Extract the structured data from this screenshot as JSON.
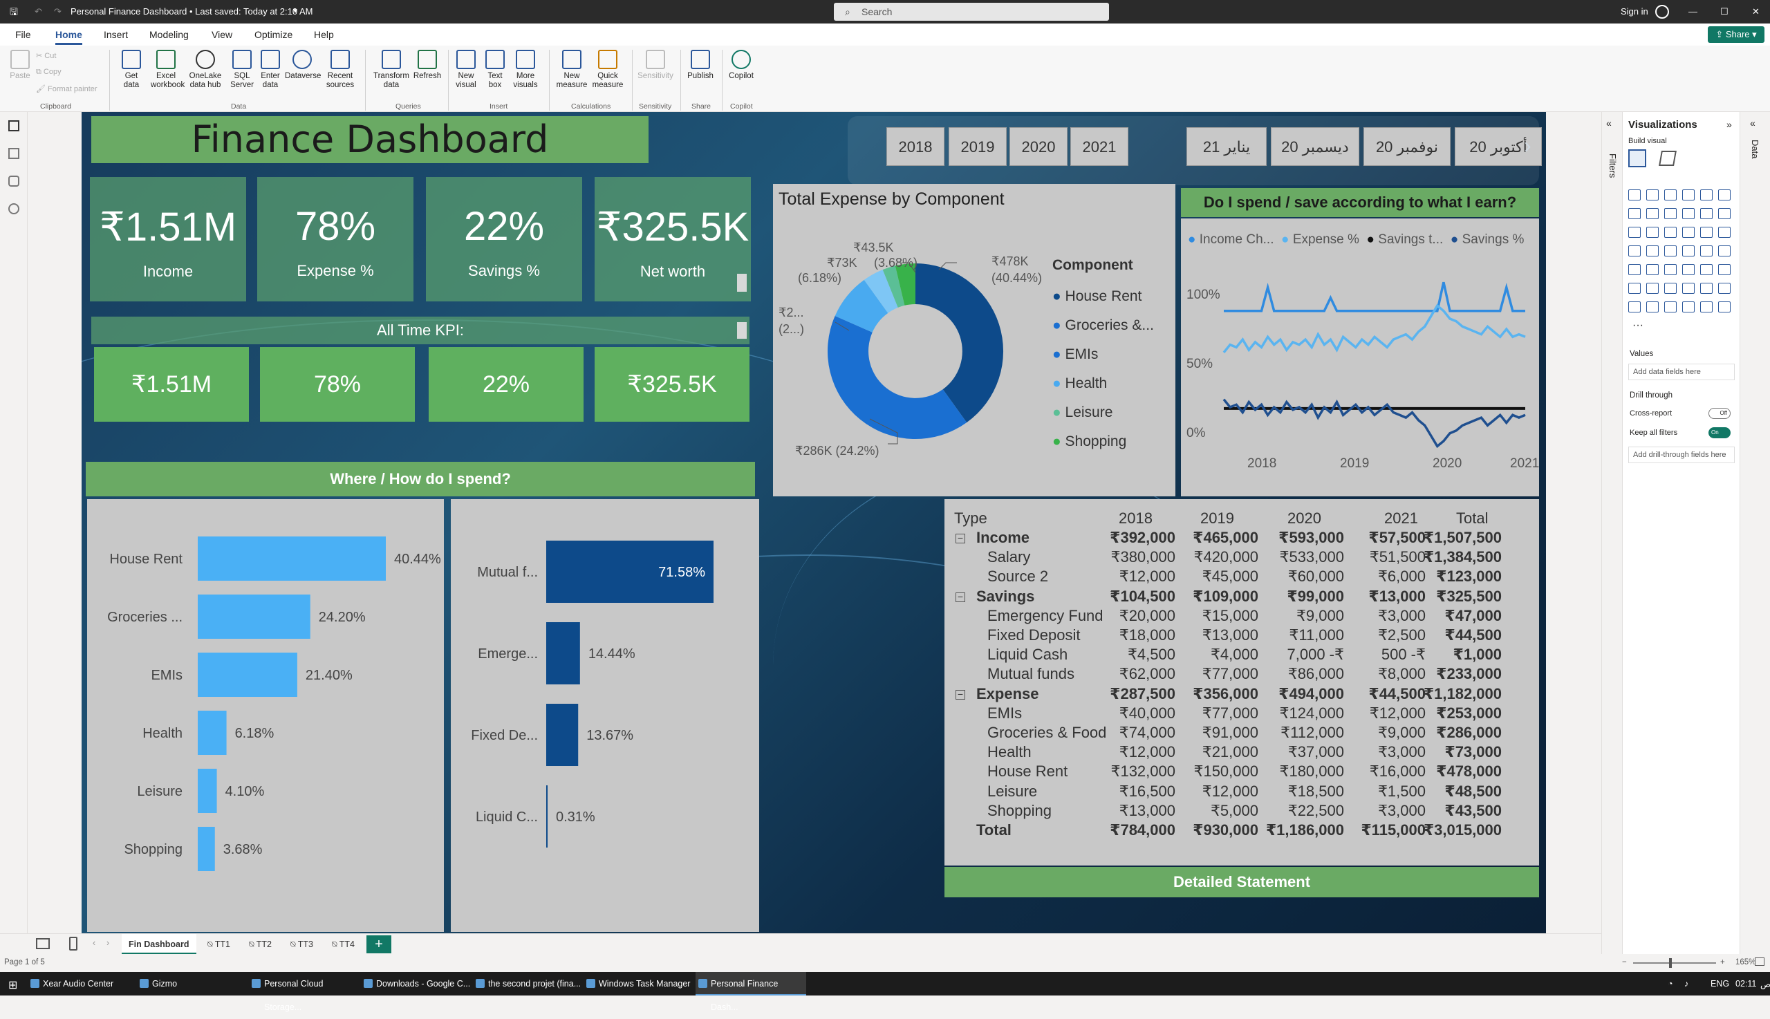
{
  "window": {
    "title": "Personal Finance Dashboard • Last saved: Today at 2:10 AM",
    "search_placeholder": "Search",
    "sign_in": "Sign in",
    "share": "Share"
  },
  "menu": [
    "File",
    "Home",
    "Insert",
    "Modeling",
    "View",
    "Optimize",
    "Help"
  ],
  "ribbon": {
    "clipboard": {
      "paste": "Paste",
      "cut": "Cut",
      "copy": "Copy",
      "format_painter": "Format painter",
      "group": "Clipboard"
    },
    "data_items": [
      "Get data",
      "Excel workbook",
      "OneLake data hub",
      "SQL Server",
      "Enter data",
      "Dataverse",
      "Recent sources"
    ],
    "data_group": "Data",
    "queries_items": [
      "Transform data",
      "Refresh"
    ],
    "queries_group": "Queries",
    "insert_items": [
      "New visual",
      "Text box",
      "More visuals"
    ],
    "insert_group": "Insert",
    "calc_items": [
      "New measure",
      "Quick measure"
    ],
    "calc_group": "Calculations",
    "sensitivity_items": [
      "Sensitivity"
    ],
    "sensitivity_group": "Sensitivity",
    "share_items": [
      "Publish"
    ],
    "share_group": "Share",
    "copilot_items": [
      "Copilot"
    ],
    "copilot_group": "Copilot"
  },
  "dashboard": {
    "title": "Finance Dashboard",
    "years": [
      "2018",
      "2019",
      "2020",
      "2021"
    ],
    "months": [
      "21 يناير",
      "20 ديسمبر",
      "20 نوفمبر",
      "20 أكتوبر"
    ],
    "kpis": [
      {
        "value": "₹1.51M",
        "label": "Income"
      },
      {
        "value": "78%",
        "label": "Expense %"
      },
      {
        "value": "22%",
        "label": "Savings %"
      },
      {
        "value": "₹325.5K",
        "label": "Net worth"
      }
    ],
    "all_time_title": "All Time KPI:",
    "all_time": [
      "₹1.51M",
      "78%",
      "22%",
      "₹325.5K"
    ],
    "spend_title": "Where / How do I spend?",
    "spend_left": [
      {
        "label": "House Rent",
        "pct": 40.44,
        "text": "40.44%"
      },
      {
        "label": "Groceries ...",
        "pct": 24.2,
        "text": "24.20%"
      },
      {
        "label": "EMIs",
        "pct": 21.4,
        "text": "21.40%"
      },
      {
        "label": "Health",
        "pct": 6.18,
        "text": "6.18%"
      },
      {
        "label": "Leisure",
        "pct": 4.1,
        "text": "4.10%"
      },
      {
        "label": "Shopping",
        "pct": 3.68,
        "text": "3.68%"
      }
    ],
    "spend_right": [
      {
        "label": "Mutual f...",
        "pct": 71.58,
        "text": "71.58%"
      },
      {
        "label": "Emerge...",
        "pct": 14.44,
        "text": "14.44%"
      },
      {
        "label": "Fixed De...",
        "pct": 13.67,
        "text": "13.67%"
      },
      {
        "label": "Liquid C...",
        "pct": 0.31,
        "text": "0.31%"
      }
    ],
    "statement_title": "Detailed Statement"
  },
  "donut": {
    "title": "Total Expense by Component",
    "legend_title": "Component",
    "legend": [
      "House Rent",
      "Groceries &...",
      "EMIs",
      "Health",
      "Leisure",
      "Shopping"
    ],
    "labels": {
      "house": "₹478K",
      "house_pct": "(40.44%)",
      "groc": "₹286K (24.2%)",
      "emi": "₹2...",
      "emi_pct": "(2...)",
      "health": "₹73K",
      "health_pct": "(6.18%)",
      "leisure": "₹43.5K",
      "leisure_pct": "(3.68%)"
    }
  },
  "chart_data": {
    "type": "line",
    "title": "Do I spend / save according to what I earn?",
    "legend": [
      "Income Ch...",
      "Expense %",
      "Savings t...",
      "Savings %"
    ],
    "x_ticks": [
      "2018",
      "2019",
      "2020",
      "2021"
    ],
    "y_ticks": [
      "0%",
      "50%",
      "100%"
    ],
    "ylim": [
      0,
      120
    ],
    "series": [
      {
        "name": "Income Ch...",
        "color": "#2f8be0",
        "values": [
          100,
          100,
          100,
          100,
          100,
          100,
          100,
          118,
          100,
          100,
          100,
          100,
          100,
          100,
          100,
          100,
          100,
          110,
          100,
          100,
          100,
          100,
          100,
          100,
          100,
          100,
          100,
          100,
          100,
          100,
          100,
          100,
          100,
          100,
          100,
          122,
          100,
          100,
          100,
          100,
          100,
          100,
          100,
          100,
          100,
          118,
          100,
          100,
          100
        ]
      },
      {
        "name": "Expense %",
        "color": "#5ab4f0",
        "values": [
          68,
          74,
          72,
          78,
          70,
          76,
          72,
          80,
          74,
          78,
          70,
          76,
          74,
          78,
          72,
          82,
          74,
          78,
          70,
          80,
          76,
          72,
          78,
          74,
          80,
          76,
          72,
          78,
          80,
          82,
          78,
          84,
          88,
          96,
          104,
          100,
          94,
          92,
          88,
          86,
          84,
          82,
          88,
          84,
          80,
          86,
          80,
          82,
          80
        ]
      },
      {
        "name": "Savings t...",
        "color": "#111111",
        "values": [
          25,
          25,
          25,
          25,
          25,
          25,
          25,
          25,
          25,
          25,
          25,
          25,
          25,
          25,
          25,
          25,
          25,
          25,
          25,
          25,
          25,
          25,
          25,
          25,
          25,
          25,
          25,
          25,
          25,
          25,
          25,
          25,
          25,
          25,
          25,
          25,
          25,
          25,
          25,
          25,
          25,
          25,
          25,
          25,
          25,
          25,
          25,
          25,
          25
        ]
      },
      {
        "name": "Savings %",
        "color": "#1f4f8f",
        "values": [
          32,
          26,
          28,
          22,
          30,
          24,
          28,
          20,
          26,
          22,
          30,
          24,
          26,
          22,
          28,
          18,
          26,
          22,
          30,
          20,
          24,
          28,
          22,
          26,
          20,
          24,
          28,
          22,
          20,
          18,
          22,
          16,
          12,
          4,
          -4,
          0,
          6,
          8,
          12,
          14,
          16,
          18,
          12,
          16,
          20,
          14,
          20,
          18,
          20
        ]
      }
    ]
  },
  "table": {
    "headers": [
      "Type",
      "2018",
      "2019",
      "2020",
      "2021",
      "Total"
    ],
    "rows": [
      {
        "type": "group",
        "label": "Income",
        "vals": [
          "₹392,000",
          "₹465,000",
          "₹593,000",
          "₹57,500",
          "₹1,507,500"
        ]
      },
      {
        "type": "item",
        "label": "Salary",
        "vals": [
          "₹380,000",
          "₹420,000",
          "₹533,000",
          "₹51,500",
          "₹1,384,500"
        ]
      },
      {
        "type": "item",
        "label": "Source 2",
        "vals": [
          "₹12,000",
          "₹45,000",
          "₹60,000",
          "₹6,000",
          "₹123,000"
        ]
      },
      {
        "type": "group",
        "label": "Savings",
        "vals": [
          "₹104,500",
          "₹109,000",
          "₹99,000",
          "₹13,000",
          "₹325,500"
        ]
      },
      {
        "type": "item",
        "label": "Emergency Fund",
        "vals": [
          "₹20,000",
          "₹15,000",
          "₹9,000",
          "₹3,000",
          "₹47,000"
        ]
      },
      {
        "type": "item",
        "label": "Fixed Deposit",
        "vals": [
          "₹18,000",
          "₹13,000",
          "₹11,000",
          "₹2,500",
          "₹44,500"
        ]
      },
      {
        "type": "item",
        "label": "Liquid Cash",
        "vals": [
          "₹4,500",
          "₹4,000",
          "7,000 -₹",
          "500 -₹",
          "₹1,000"
        ]
      },
      {
        "type": "item",
        "label": "Mutual funds",
        "vals": [
          "₹62,000",
          "₹77,000",
          "₹86,000",
          "₹8,000",
          "₹233,000"
        ]
      },
      {
        "type": "group",
        "label": "Expense",
        "vals": [
          "₹287,500",
          "₹356,000",
          "₹494,000",
          "₹44,500",
          "₹1,182,000"
        ]
      },
      {
        "type": "item",
        "label": "EMIs",
        "vals": [
          "₹40,000",
          "₹77,000",
          "₹124,000",
          "₹12,000",
          "₹253,000"
        ]
      },
      {
        "type": "item",
        "label": "Groceries & Food",
        "vals": [
          "₹74,000",
          "₹91,000",
          "₹112,000",
          "₹9,000",
          "₹286,000"
        ]
      },
      {
        "type": "item",
        "label": "Health",
        "vals": [
          "₹12,000",
          "₹21,000",
          "₹37,000",
          "₹3,000",
          "₹73,000"
        ]
      },
      {
        "type": "item",
        "label": "House Rent",
        "vals": [
          "₹132,000",
          "₹150,000",
          "₹180,000",
          "₹16,000",
          "₹478,000"
        ]
      },
      {
        "type": "item",
        "label": "Leisure",
        "vals": [
          "₹16,500",
          "₹12,000",
          "₹18,500",
          "₹1,500",
          "₹48,500"
        ]
      },
      {
        "type": "item",
        "label": "Shopping",
        "vals": [
          "₹13,000",
          "₹5,000",
          "₹22,500",
          "₹3,000",
          "₹43,500"
        ]
      },
      {
        "type": "total",
        "label": "Total",
        "vals": [
          "₹784,000",
          "₹930,000",
          "₹1,186,000",
          "₹115,000",
          "₹3,015,000"
        ]
      }
    ]
  },
  "viz_pane": {
    "title": "Visualizations",
    "build": "Build visual",
    "filters": "Filters",
    "data": "Data",
    "values": "Values",
    "add_data": "Add data fields here",
    "drill": "Drill through",
    "cross_report": "Cross-report",
    "cross_state": "Off",
    "keep_filters": "Keep all filters",
    "keep_state": "On",
    "add_drill": "Add drill-through fields here"
  },
  "tabs": [
    "Fin Dashboard",
    "TT1",
    "TT2",
    "TT3",
    "TT4"
  ],
  "status": {
    "page": "Page 1 of 5",
    "zoom": "165%"
  },
  "taskbar": {
    "apps": [
      "Xear Audio Center",
      "Gizmo",
      "Personal Cloud Storage...",
      "Downloads - Google C...",
      "the second projet (fina...",
      "Windows Task Manager",
      "Personal Finance Dash..."
    ],
    "lang": "ENG",
    "time": "02:11",
    "ampm": "ص"
  },
  "colors": {
    "accent": "#117865",
    "green": "#6aaa64",
    "navy": "#0d4a8a",
    "mid": "#1a6fd1",
    "light": "#49aaf0",
    "pale": "#7ec6f5",
    "teal": "#5bbf96",
    "leaf": "#38b24a",
    "bar_light": "#4ab0f5",
    "bar_dark": "#0d4a8a"
  }
}
